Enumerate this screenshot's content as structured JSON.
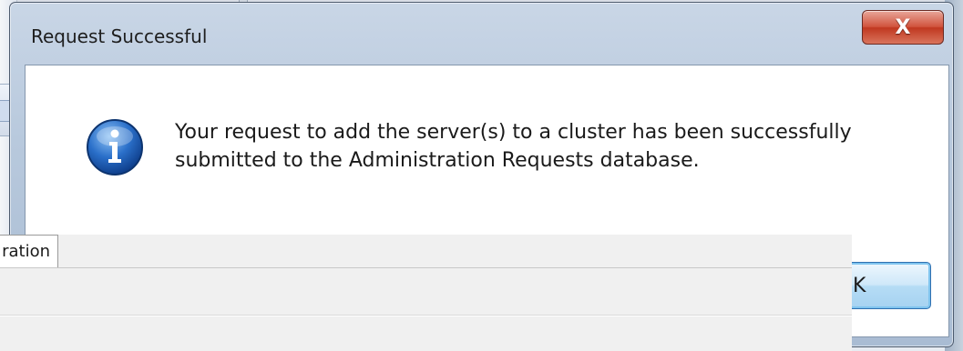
{
  "dialog": {
    "title": "Request Successful",
    "close_label": "X",
    "message_line1": "Your request to add the server(s) to a cluster has been successfully",
    "message_line2": "submitted to the Administration Requests database.",
    "icon": "info-icon",
    "ok_label": "K"
  },
  "background": {
    "tab_label": "ration"
  },
  "colors": {
    "close_button": "#c9432c",
    "ok_button": "#b5dcf5",
    "info_icon": "#1f5fb4"
  }
}
